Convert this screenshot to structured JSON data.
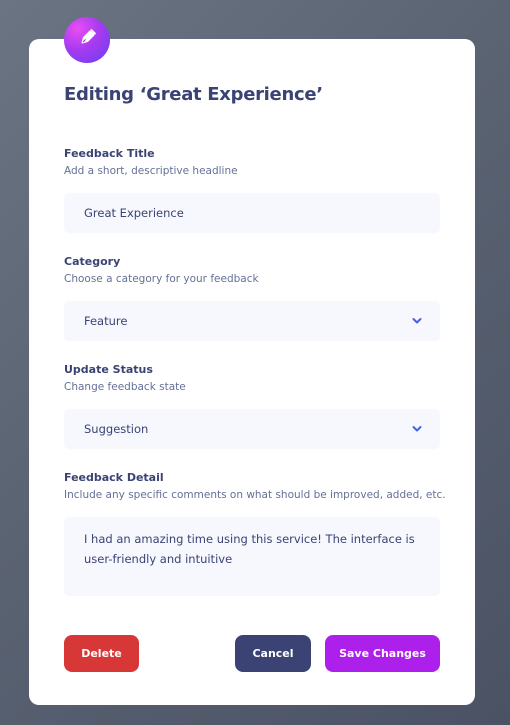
{
  "form": {
    "heading": "Editing ‘Great Experience’",
    "icon": "pen-icon",
    "accent_color": "#AD1FEA",
    "fields": {
      "title": {
        "label": "Feedback Title",
        "description": "Add a short, descriptive headline",
        "value": "Great Experience"
      },
      "category": {
        "label": "Category",
        "description": "Choose a category for your feedback",
        "value": "Feature"
      },
      "status": {
        "label": "Update Status",
        "description": "Change feedback state",
        "value": "Suggestion"
      },
      "detail": {
        "label": "Feedback Detail",
        "description": "Include any specific comments on what should be improved, added, etc.",
        "value": "I had an amazing time using this service! The interface is user-friendly and intuitive"
      }
    },
    "buttons": {
      "delete": "Delete",
      "cancel": "Cancel",
      "save": "Save Changes"
    }
  }
}
